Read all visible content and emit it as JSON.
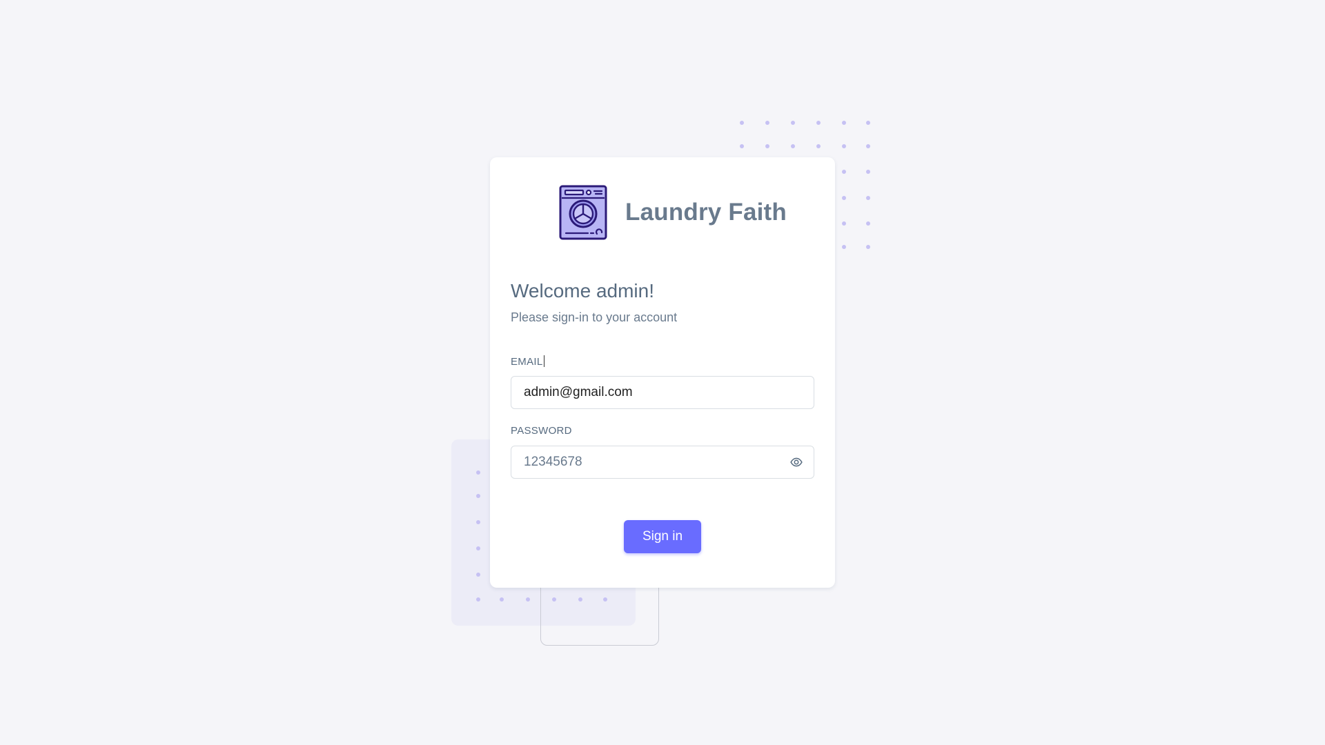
{
  "brand": {
    "name": "Laundry Faith",
    "logo_icon": "washing-machine-icon"
  },
  "welcome": {
    "title": "Welcome admin!",
    "subtitle": "Please sign-in to your account"
  },
  "form": {
    "email_label": "EMAIL",
    "email_value": "admin@gmail.com",
    "password_label": "PASSWORD",
    "password_value": "12345678",
    "password_toggle_icon": "eye-icon",
    "submit_label": "Sign in"
  },
  "colors": {
    "primary": "#696cff",
    "background": "#f5f5f9",
    "text": "#566a7f",
    "muted_text": "#697a8d",
    "dot_pattern": "#c6c1f3"
  }
}
